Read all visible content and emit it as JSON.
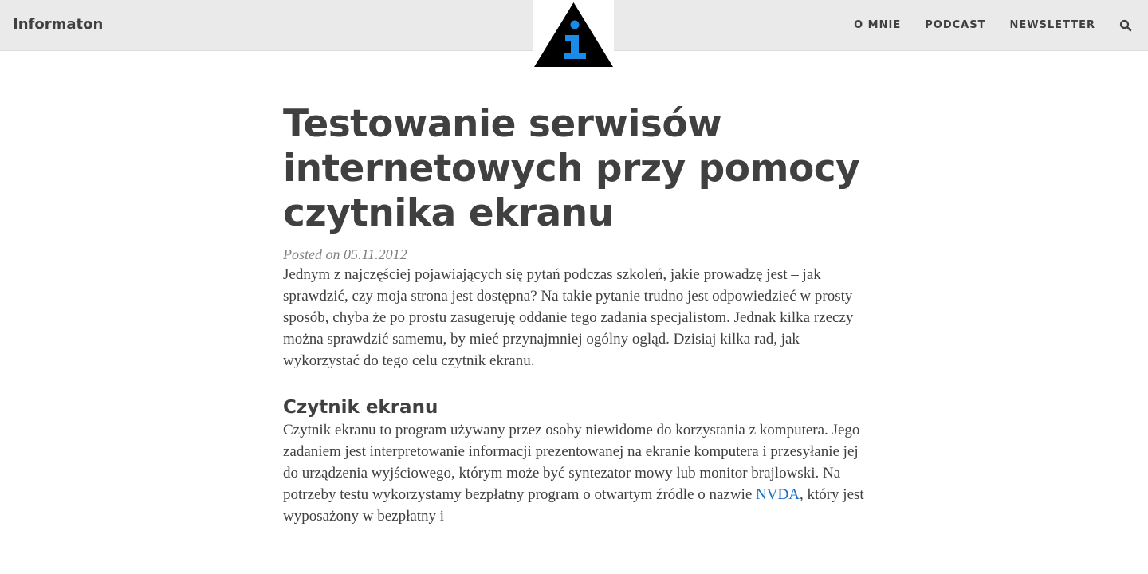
{
  "navbar": {
    "brand": "Informaton",
    "links": [
      "O MNIE",
      "PODCAST",
      "NEWSLETTER"
    ],
    "search_icon": "search-icon",
    "logo": {
      "letter": "i",
      "colors": {
        "triangle": "#000000",
        "letter": "#1a8be6"
      }
    }
  },
  "post": {
    "title": "Testowanie serwisów internetowych przy pomocy czytnika ekranu",
    "meta": "Posted on 05.11.2012",
    "intro": "Jednym z najczęściej pojawiających się pytań podczas szkoleń, jakie prowadzę jest – jak sprawdzić, czy moja strona jest dostępna? Na takie pytanie trudno jest odpowiedzieć w prosty sposób, chyba że po prostu zasugeruję oddanie tego zadania specjalistom. Jednak kilka rzeczy można sprawdzić samemu, by mieć przynajmniej ogólny ogląd. Dzisiaj kilka rad, jak wykorzystać do tego celu czytnik ekranu.",
    "section_heading": "Czytnik ekranu",
    "para2_before": "Czytnik ekranu to program używany przez osoby niewidome do korzystania z komputera. Jego zadaniem jest interpretowanie informacji prezentowanej na ekranie komputera i przesyłanie jej do urządzenia wyjściowego, którym może być syntezator mowy lub monitor brajlowski. Na potrzeby testu wykorzystamy bezpłatny program o otwartym źródle o nazwie ",
    "para2_link": "NVDA",
    "para2_after": ", który jest wyposażony w bezpłatny i"
  },
  "colors": {
    "navbar_bg": "#eaeaea",
    "text": "#404040",
    "meta": "#808080",
    "link": "#1a6fc4"
  }
}
